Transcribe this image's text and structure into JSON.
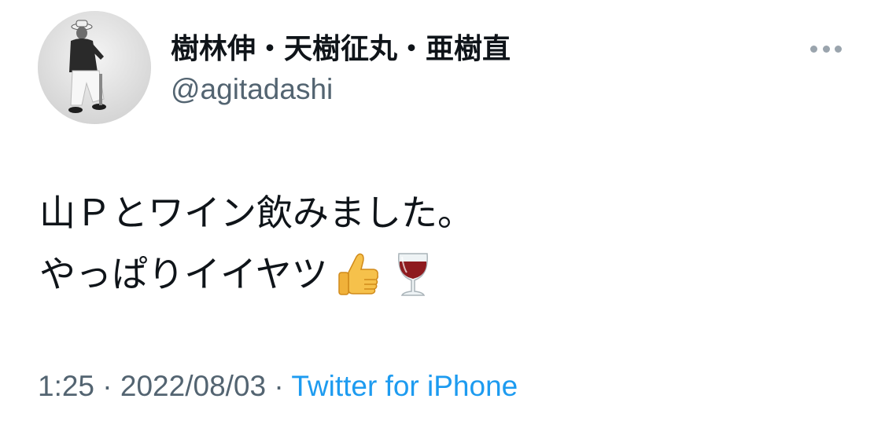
{
  "user": {
    "display_name": "樹林伸・天樹征丸・亜樹直",
    "handle": "@agitadashi",
    "avatar_icon": "user-avatar-photo"
  },
  "tweet": {
    "line1": "山Ｐとワイン飲みました。",
    "line2": "やっぱりイイヤツ",
    "emojis": [
      "thumbs-up-icon",
      "wine-glass-icon"
    ]
  },
  "meta": {
    "time": "1:25",
    "sep1": " · ",
    "date": "2022/08/03",
    "sep2": " · ",
    "source": "Twitter for iPhone"
  },
  "more_icon": "more-horizontal-icon",
  "colors": {
    "text": "#0f1419",
    "secondary": "#536471",
    "link": "#1d9bf0",
    "more_dots": "#9aa4ad"
  }
}
